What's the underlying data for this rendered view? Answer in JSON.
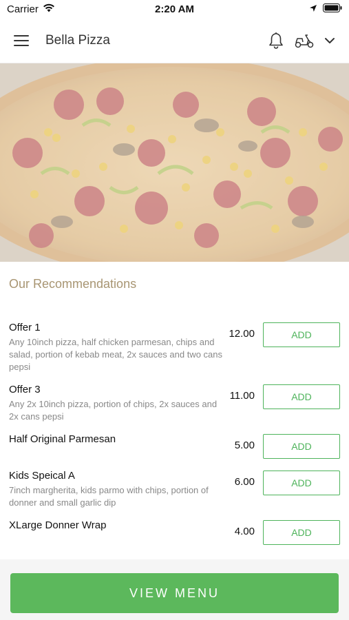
{
  "status_bar": {
    "carrier": "Carrier",
    "time": "2:20 AM"
  },
  "header": {
    "title": "Bella Pizza",
    "icons": [
      "menu-icon",
      "bell-icon",
      "scooter-icon",
      "chevron-down-icon"
    ]
  },
  "section": {
    "title": "Our Recommendations"
  },
  "items": [
    {
      "name": "Offer 1",
      "description": "Any 10inch pizza, half chicken parmesan, chips and salad, portion of kebab meat, 2x sauces and two cans pepsi",
      "price": "12.00",
      "button": "ADD"
    },
    {
      "name": "Offer 3",
      "description": "Any 2x 10inch pizza, portion of chips, 2x sauces and 2x cans pepsi",
      "price": "11.00",
      "button": "ADD"
    },
    {
      "name": "Half Original Parmesan",
      "description": "",
      "price": "5.00",
      "button": "ADD"
    },
    {
      "name": "Kids Speical A",
      "description": "7inch margherita, kids parmo with chips, portion of donner and small garlic dip",
      "price": "6.00",
      "button": "ADD"
    },
    {
      "name": "XLarge Donner Wrap",
      "description": "",
      "price": "4.00",
      "button": "ADD"
    }
  ],
  "footer": {
    "button": "VIEW MENU"
  },
  "colors": {
    "accent": "#5cb85c",
    "section_title": "#a89572"
  }
}
